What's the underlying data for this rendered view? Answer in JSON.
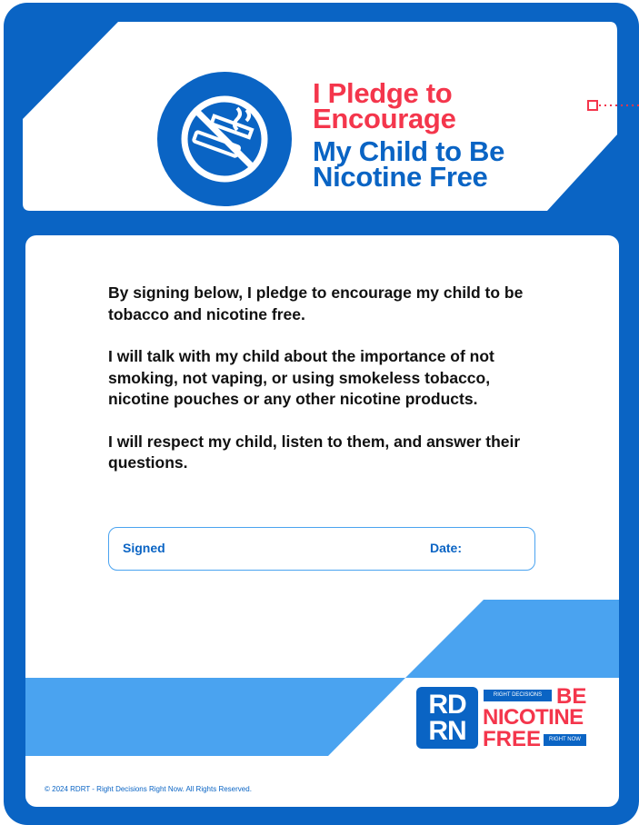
{
  "header": {
    "title_line1": "I Pledge to",
    "title_line2": "Encourage",
    "title_line3": "My Child to Be",
    "title_line4": "Nicotine Free"
  },
  "icons": {
    "badge": "no-smoking-no-vaping-icon"
  },
  "pledge": {
    "paragraph1": "By signing below, I pledge to encourage my child to be tobacco and nicotine free.",
    "paragraph2": "I will talk with my child about the importance of not smoking, not vaping, or using smokeless tobacco, nicotine pouches or any other nicotine products.",
    "paragraph3": "I will respect my child, listen to them, and answer their questions."
  },
  "signature": {
    "signed_label": "Signed",
    "date_label": "Date:"
  },
  "logo": {
    "rdrn_top": "RD",
    "rdrn_bottom": "RN",
    "tagline_top": "RIGHT DECISIONS",
    "be": "BE",
    "nicotine": "NICOTINE",
    "free": "FREE",
    "tagline_bottom": "RIGHT NOW"
  },
  "footer": {
    "copyright": "© 2024 RDRT - Right Decisions Right Now. All Rights Reserved."
  },
  "colors": {
    "primary_blue": "#0a64c4",
    "accent_red": "#f4364c",
    "light_blue": "#4aa3f0"
  }
}
